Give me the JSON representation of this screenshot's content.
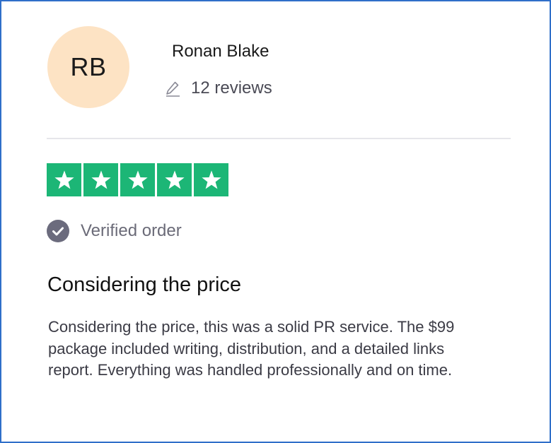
{
  "reviewer": {
    "initials": "RB",
    "name": "Ronan Blake",
    "review_count": "12 reviews",
    "avatar_color": "#fde3c4"
  },
  "rating": {
    "stars": 5,
    "max_stars": 5,
    "star_color": "#1cb676"
  },
  "verification": {
    "label": "Verified order",
    "icon": "check-circle-icon"
  },
  "review": {
    "title": "Considering the price",
    "body": "Considering the price, this was a solid PR service. The $99 package included writing, distribution, and a detailed links report. Everything was handled professionally and on time."
  },
  "colors": {
    "border": "#2f6fc9",
    "divider": "#e6e6ea"
  }
}
